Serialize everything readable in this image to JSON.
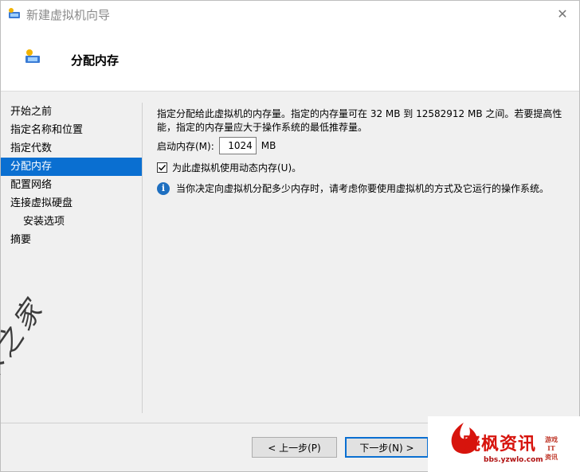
{
  "window": {
    "title": "新建虚拟机向导",
    "close_glyph": "✕"
  },
  "header": {
    "title": "分配内存"
  },
  "nav": {
    "items": [
      {
        "label": "开始之前"
      },
      {
        "label": "指定名称和位置"
      },
      {
        "label": "指定代数"
      },
      {
        "label": "分配内存"
      },
      {
        "label": "配置网络"
      },
      {
        "label": "连接虚拟硬盘"
      },
      {
        "label": "安装选项"
      },
      {
        "label": "摘要"
      }
    ],
    "active_index": 3
  },
  "content": {
    "description": "指定分配给此虚拟机的内存量。指定的内存量可在 32 MB 到 12582912 MB 之间。若要提高性能，指定的内存量应大于操作系统的最低推荐量。",
    "startup_memory_label": "启动内存(M):",
    "startup_memory_value": "1024",
    "startup_memory_unit": "MB",
    "dynamic_memory_label": "为此虚拟机使用动态内存(U)。",
    "dynamic_memory_checked": true,
    "info_text": "当你决定向虚拟机分配多少内存时，请考虑你要使用虚拟机的方式及它运行的操作系统。"
  },
  "buttons": {
    "prev": "< 上一步(P)",
    "next": "下一步(N) >"
  },
  "watermark": {
    "text": "树木之家"
  },
  "logo": {
    "name": "晓枫资讯",
    "url": "bbs.yzwlo.com",
    "side": "游戏 IT 资讯"
  },
  "colors": {
    "accent": "#0a6fd1",
    "info_icon": "#1e6fc0",
    "logo_red": "#d7140d"
  }
}
